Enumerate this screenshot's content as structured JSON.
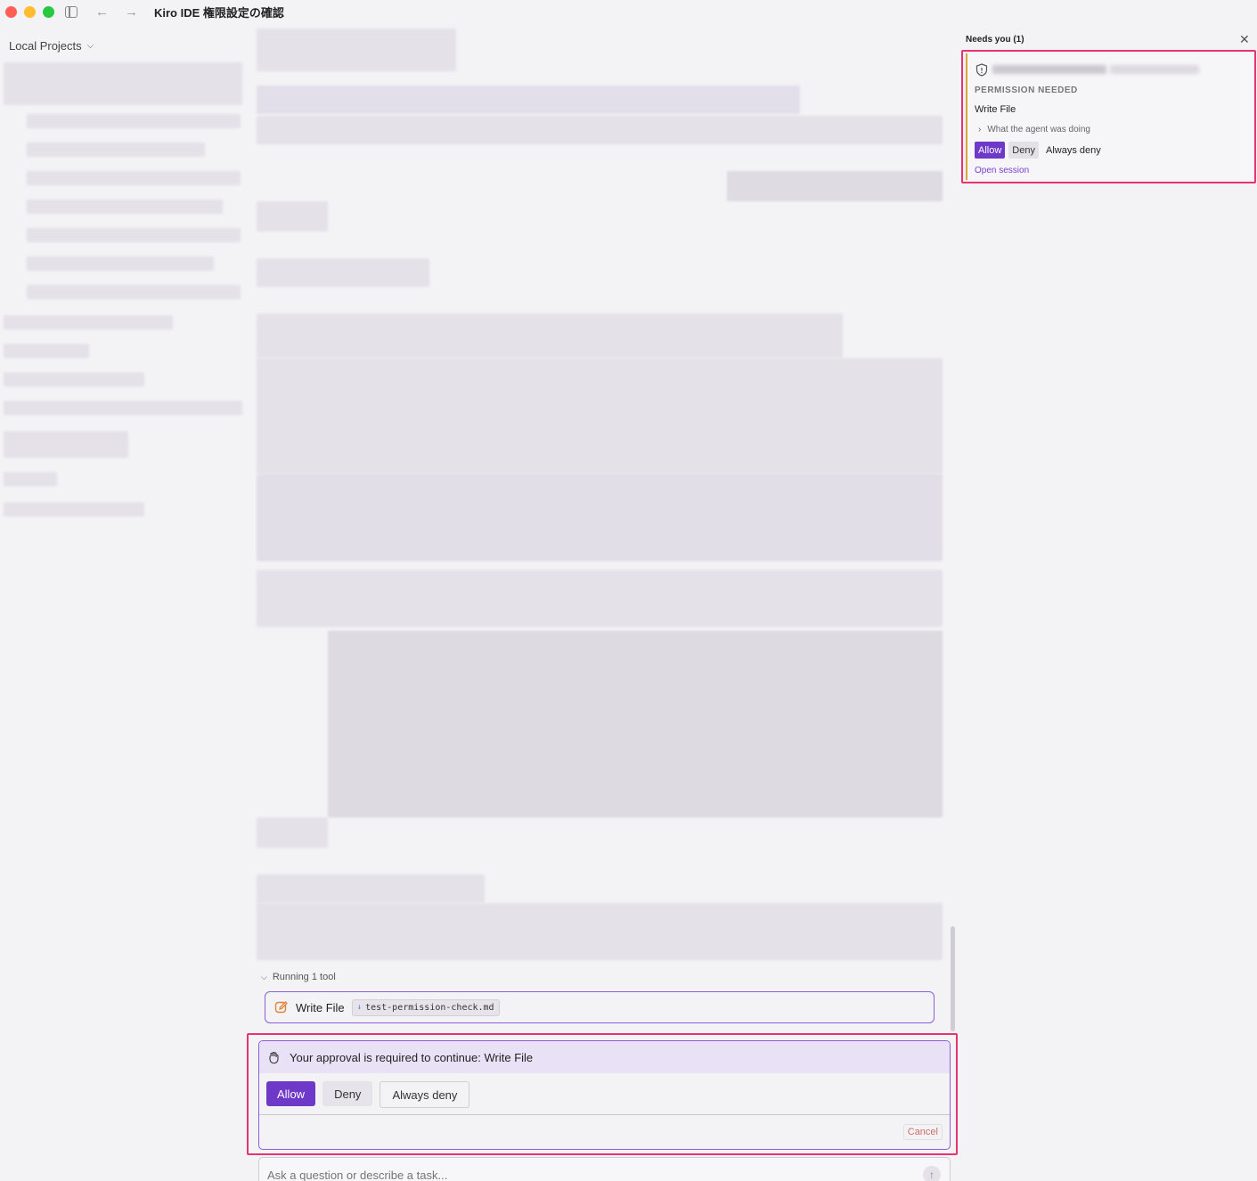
{
  "window": {
    "title": "Kiro IDE 権限設定の確認"
  },
  "sidebar": {
    "header": "Local Projects"
  },
  "chat": {
    "running_label": "Running 1 tool",
    "tool": {
      "name": "Write File",
      "file": "test-permission-check.md"
    },
    "approval": {
      "message": "Your approval is required to continue: Write File",
      "allow": "Allow",
      "deny": "Deny",
      "always_deny": "Always deny",
      "cancel": "Cancel"
    },
    "input_placeholder": "Ask a question or describe a task..."
  },
  "needs_panel": {
    "title": "Needs you (1)",
    "card": {
      "label": "PERMISSION NEEDED",
      "tool": "Write File",
      "what_doing": "What the agent was doing",
      "allow": "Allow",
      "deny": "Deny",
      "always_deny": "Always deny",
      "open_session": "Open session"
    }
  },
  "colors": {
    "accent": "#6e38c9",
    "highlight_frame": "#e8336f",
    "pending": "#d9a63a"
  }
}
